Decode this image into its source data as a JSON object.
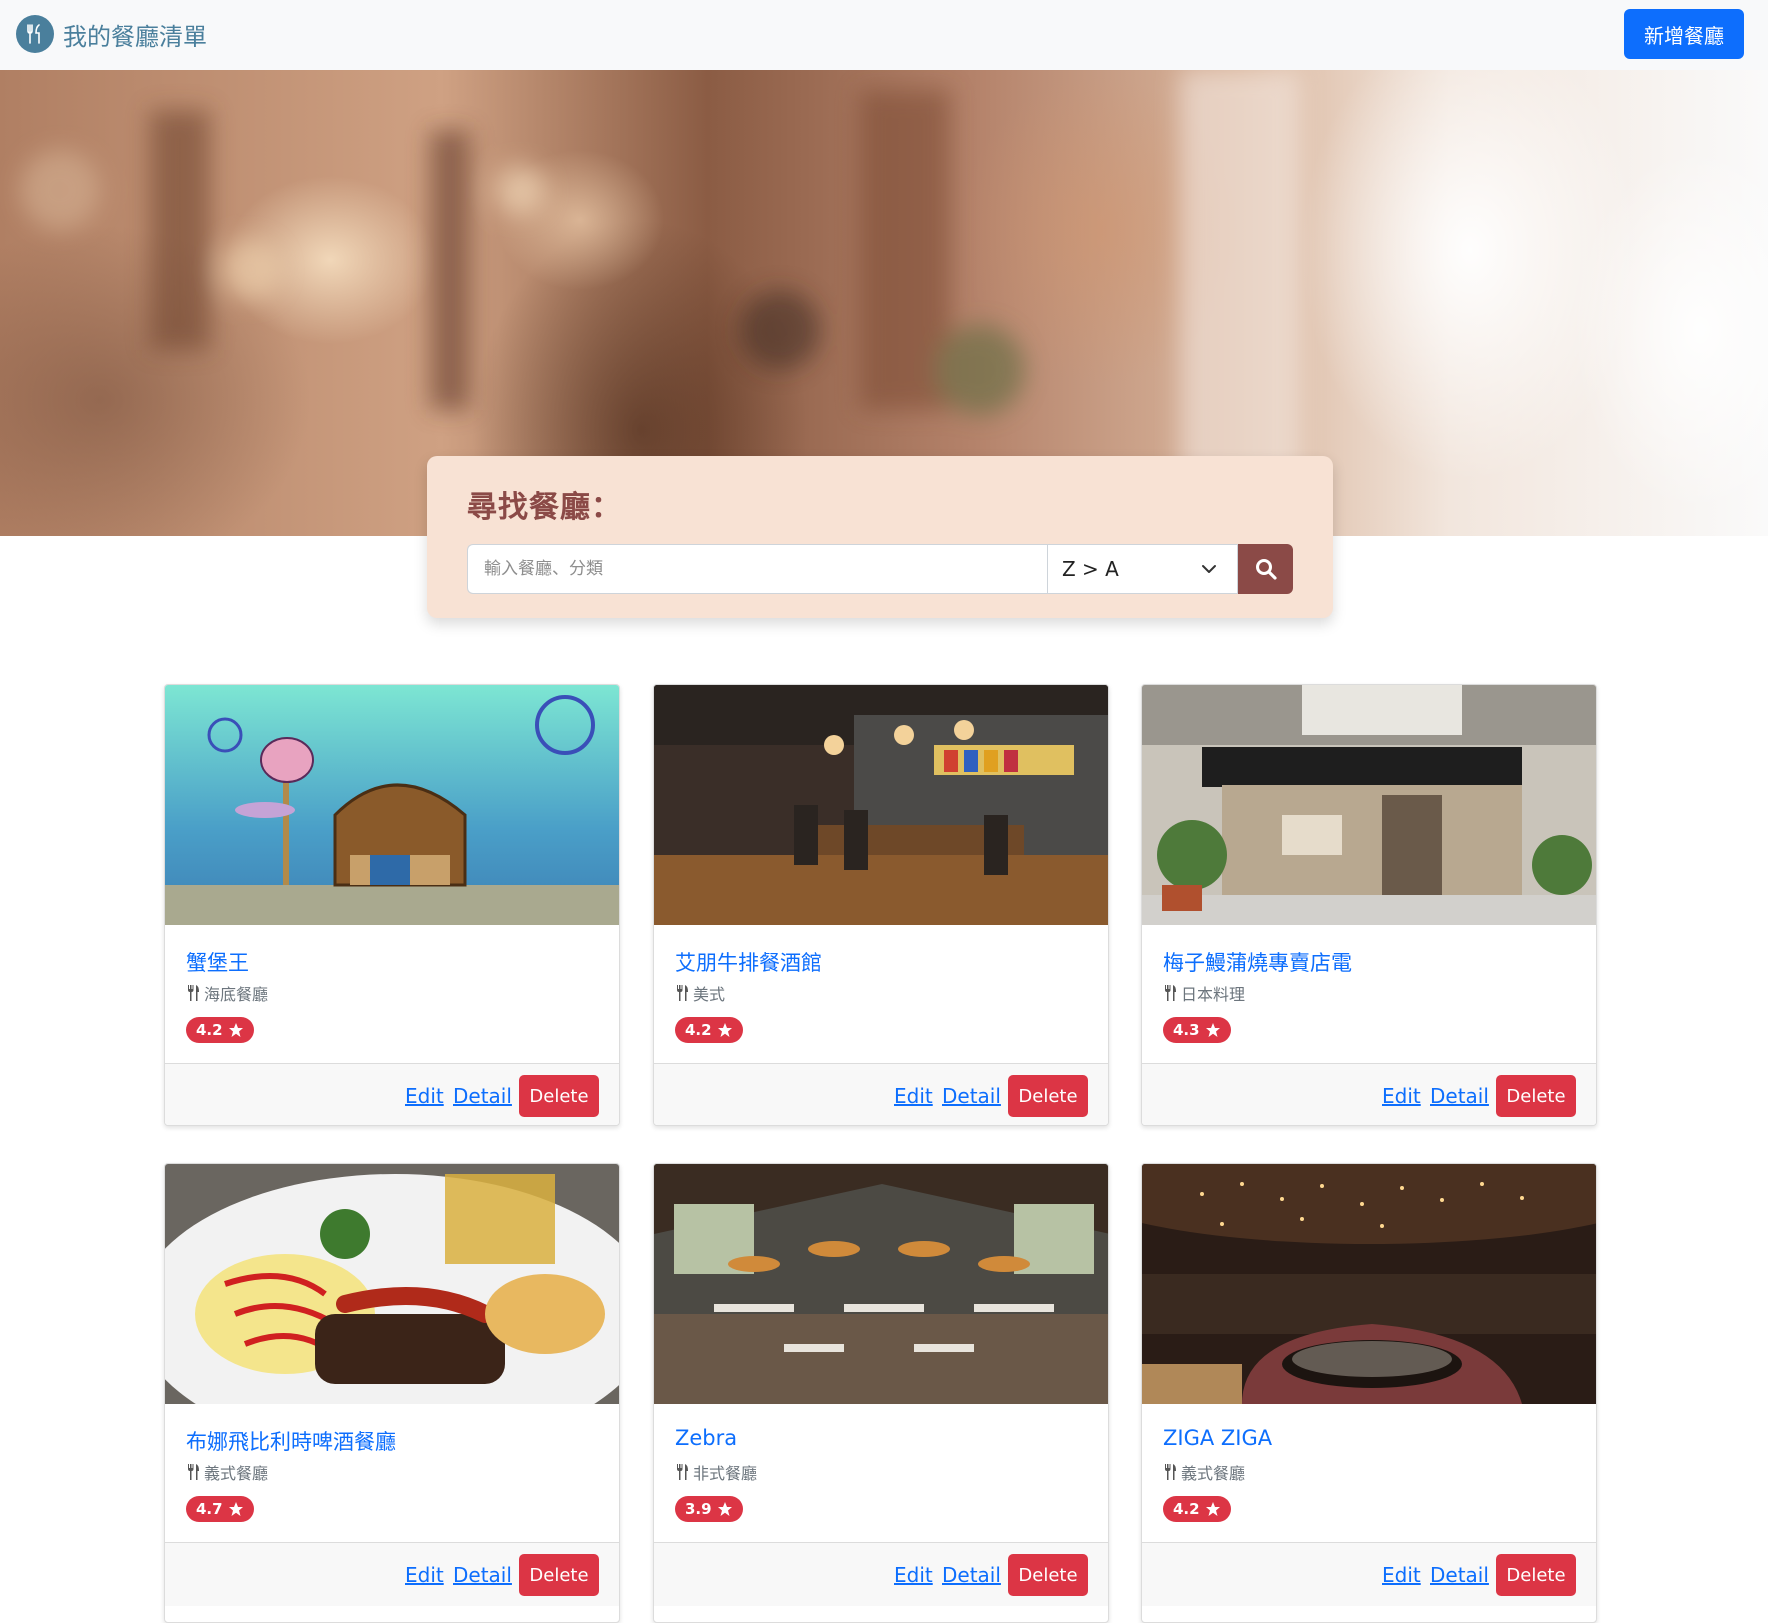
{
  "navbar": {
    "brand": "我的餐廳清單",
    "brand_icon": "utensils-icon",
    "new_button": "新增餐廳"
  },
  "search": {
    "title": "尋找餐廳：",
    "placeholder": "輸入餐廳、分類",
    "sort_value": "Z > A",
    "search_icon": "magnifier-icon"
  },
  "restaurants": [
    {
      "name": "蟹堡王",
      "category": "海底餐廳",
      "rating": "4.2"
    },
    {
      "name": "艾朋牛排餐酒館",
      "category": "美式",
      "rating": "4.2"
    },
    {
      "name": "梅子鰻蒲燒專賣店電",
      "category": "日本料理",
      "rating": "4.3"
    },
    {
      "name": "布娜飛比利時啤酒餐廳",
      "category": "義式餐廳",
      "rating": "4.7"
    },
    {
      "name": "Zebra",
      "category": "非式餐廳",
      "rating": "3.9"
    },
    {
      "name": "ZIGA ZIGA",
      "category": "義式餐廳",
      "rating": "4.2"
    }
  ],
  "card_actions": {
    "edit": "Edit",
    "detail": "Detail",
    "delete": "Delete"
  },
  "colors": {
    "primary": "#0d6efd",
    "brand": "#4a7f9c",
    "search_panel": "#f8e2d4",
    "search_button": "#8b4a47",
    "danger": "#dc3545"
  }
}
